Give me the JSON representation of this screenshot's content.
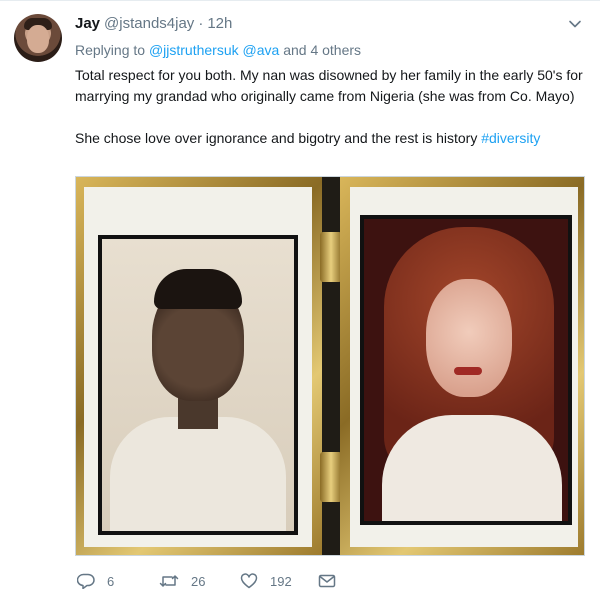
{
  "tweet": {
    "author_name": "Jay",
    "author_handle": "@jstands4jay",
    "separator": "·",
    "time": "12h",
    "replying_prefix": "Replying to",
    "replying_user1": "@jjstruthersuk",
    "replying_user2": "@ava",
    "replying_suffix": "and 4 others",
    "text_line1": "Total respect for you both. My nan was disowned by her family in the early 50's for marrying my grandad who originally came from Nigeria (she was from Co. Mayo)",
    "text_line2": "She chose love over ignorance and bigotry and the rest is history",
    "hashtag": "#diversity",
    "reply_count": "6",
    "retweet_count": "26",
    "like_count": "192"
  },
  "icons": {
    "chevron": "chevron-down-icon",
    "reply": "reply-icon",
    "retweet": "retweet-icon",
    "like": "heart-icon",
    "dm": "envelope-icon"
  },
  "colors": {
    "link": "#1da1f2",
    "secondary_text": "#657786",
    "primary_text": "#14171a"
  }
}
